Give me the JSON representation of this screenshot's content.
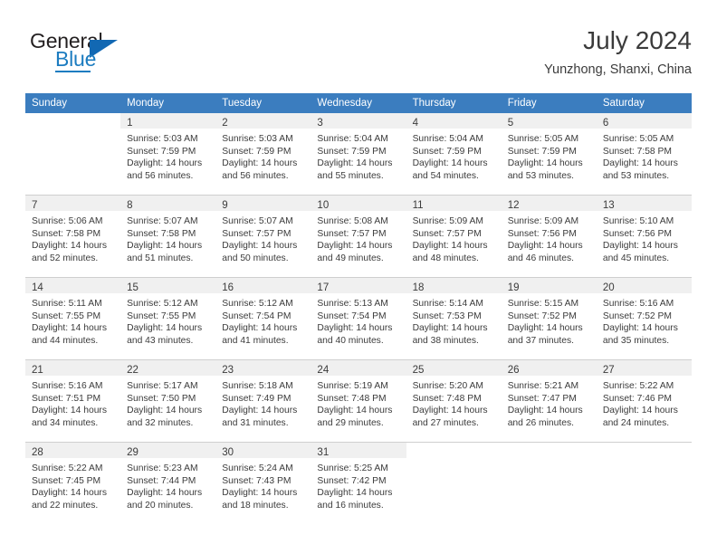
{
  "brand": {
    "name_part1": "General",
    "name_part2": "Blue",
    "logo_icon": "triangle-logo-icon",
    "accent_color": "#1268b3"
  },
  "header": {
    "month_title": "July 2024",
    "location": "Yunzhong, Shanxi, China"
  },
  "calendar": {
    "header_bg": "#3b7dbf",
    "daynum_bg": "#f0f0f0",
    "weekday_headers": [
      "Sunday",
      "Monday",
      "Tuesday",
      "Wednesday",
      "Thursday",
      "Friday",
      "Saturday"
    ],
    "weeks": [
      [
        {
          "day": "",
          "lines": [
            "",
            "",
            "",
            ""
          ],
          "empty": true
        },
        {
          "day": "1",
          "lines": [
            "Sunrise: 5:03 AM",
            "Sunset: 7:59 PM",
            "Daylight: 14 hours",
            "and 56 minutes."
          ]
        },
        {
          "day": "2",
          "lines": [
            "Sunrise: 5:03 AM",
            "Sunset: 7:59 PM",
            "Daylight: 14 hours",
            "and 56 minutes."
          ]
        },
        {
          "day": "3",
          "lines": [
            "Sunrise: 5:04 AM",
            "Sunset: 7:59 PM",
            "Daylight: 14 hours",
            "and 55 minutes."
          ]
        },
        {
          "day": "4",
          "lines": [
            "Sunrise: 5:04 AM",
            "Sunset: 7:59 PM",
            "Daylight: 14 hours",
            "and 54 minutes."
          ]
        },
        {
          "day": "5",
          "lines": [
            "Sunrise: 5:05 AM",
            "Sunset: 7:59 PM",
            "Daylight: 14 hours",
            "and 53 minutes."
          ]
        },
        {
          "day": "6",
          "lines": [
            "Sunrise: 5:05 AM",
            "Sunset: 7:58 PM",
            "Daylight: 14 hours",
            "and 53 minutes."
          ]
        }
      ],
      [
        {
          "day": "7",
          "lines": [
            "Sunrise: 5:06 AM",
            "Sunset: 7:58 PM",
            "Daylight: 14 hours",
            "and 52 minutes."
          ]
        },
        {
          "day": "8",
          "lines": [
            "Sunrise: 5:07 AM",
            "Sunset: 7:58 PM",
            "Daylight: 14 hours",
            "and 51 minutes."
          ]
        },
        {
          "day": "9",
          "lines": [
            "Sunrise: 5:07 AM",
            "Sunset: 7:57 PM",
            "Daylight: 14 hours",
            "and 50 minutes."
          ]
        },
        {
          "day": "10",
          "lines": [
            "Sunrise: 5:08 AM",
            "Sunset: 7:57 PM",
            "Daylight: 14 hours",
            "and 49 minutes."
          ]
        },
        {
          "day": "11",
          "lines": [
            "Sunrise: 5:09 AM",
            "Sunset: 7:57 PM",
            "Daylight: 14 hours",
            "and 48 minutes."
          ]
        },
        {
          "day": "12",
          "lines": [
            "Sunrise: 5:09 AM",
            "Sunset: 7:56 PM",
            "Daylight: 14 hours",
            "and 46 minutes."
          ]
        },
        {
          "day": "13",
          "lines": [
            "Sunrise: 5:10 AM",
            "Sunset: 7:56 PM",
            "Daylight: 14 hours",
            "and 45 minutes."
          ]
        }
      ],
      [
        {
          "day": "14",
          "lines": [
            "Sunrise: 5:11 AM",
            "Sunset: 7:55 PM",
            "Daylight: 14 hours",
            "and 44 minutes."
          ]
        },
        {
          "day": "15",
          "lines": [
            "Sunrise: 5:12 AM",
            "Sunset: 7:55 PM",
            "Daylight: 14 hours",
            "and 43 minutes."
          ]
        },
        {
          "day": "16",
          "lines": [
            "Sunrise: 5:12 AM",
            "Sunset: 7:54 PM",
            "Daylight: 14 hours",
            "and 41 minutes."
          ]
        },
        {
          "day": "17",
          "lines": [
            "Sunrise: 5:13 AM",
            "Sunset: 7:54 PM",
            "Daylight: 14 hours",
            "and 40 minutes."
          ]
        },
        {
          "day": "18",
          "lines": [
            "Sunrise: 5:14 AM",
            "Sunset: 7:53 PM",
            "Daylight: 14 hours",
            "and 38 minutes."
          ]
        },
        {
          "day": "19",
          "lines": [
            "Sunrise: 5:15 AM",
            "Sunset: 7:52 PM",
            "Daylight: 14 hours",
            "and 37 minutes."
          ]
        },
        {
          "day": "20",
          "lines": [
            "Sunrise: 5:16 AM",
            "Sunset: 7:52 PM",
            "Daylight: 14 hours",
            "and 35 minutes."
          ]
        }
      ],
      [
        {
          "day": "21",
          "lines": [
            "Sunrise: 5:16 AM",
            "Sunset: 7:51 PM",
            "Daylight: 14 hours",
            "and 34 minutes."
          ]
        },
        {
          "day": "22",
          "lines": [
            "Sunrise: 5:17 AM",
            "Sunset: 7:50 PM",
            "Daylight: 14 hours",
            "and 32 minutes."
          ]
        },
        {
          "day": "23",
          "lines": [
            "Sunrise: 5:18 AM",
            "Sunset: 7:49 PM",
            "Daylight: 14 hours",
            "and 31 minutes."
          ]
        },
        {
          "day": "24",
          "lines": [
            "Sunrise: 5:19 AM",
            "Sunset: 7:48 PM",
            "Daylight: 14 hours",
            "and 29 minutes."
          ]
        },
        {
          "day": "25",
          "lines": [
            "Sunrise: 5:20 AM",
            "Sunset: 7:48 PM",
            "Daylight: 14 hours",
            "and 27 minutes."
          ]
        },
        {
          "day": "26",
          "lines": [
            "Sunrise: 5:21 AM",
            "Sunset: 7:47 PM",
            "Daylight: 14 hours",
            "and 26 minutes."
          ]
        },
        {
          "day": "27",
          "lines": [
            "Sunrise: 5:22 AM",
            "Sunset: 7:46 PM",
            "Daylight: 14 hours",
            "and 24 minutes."
          ]
        }
      ],
      [
        {
          "day": "28",
          "lines": [
            "Sunrise: 5:22 AM",
            "Sunset: 7:45 PM",
            "Daylight: 14 hours",
            "and 22 minutes."
          ]
        },
        {
          "day": "29",
          "lines": [
            "Sunrise: 5:23 AM",
            "Sunset: 7:44 PM",
            "Daylight: 14 hours",
            "and 20 minutes."
          ]
        },
        {
          "day": "30",
          "lines": [
            "Sunrise: 5:24 AM",
            "Sunset: 7:43 PM",
            "Daylight: 14 hours",
            "and 18 minutes."
          ]
        },
        {
          "day": "31",
          "lines": [
            "Sunrise: 5:25 AM",
            "Sunset: 7:42 PM",
            "Daylight: 14 hours",
            "and 16 minutes."
          ]
        },
        {
          "day": "",
          "lines": [
            "",
            "",
            "",
            ""
          ],
          "empty": true
        },
        {
          "day": "",
          "lines": [
            "",
            "",
            "",
            ""
          ],
          "empty": true
        },
        {
          "day": "",
          "lines": [
            "",
            "",
            "",
            ""
          ],
          "empty": true
        }
      ]
    ]
  }
}
